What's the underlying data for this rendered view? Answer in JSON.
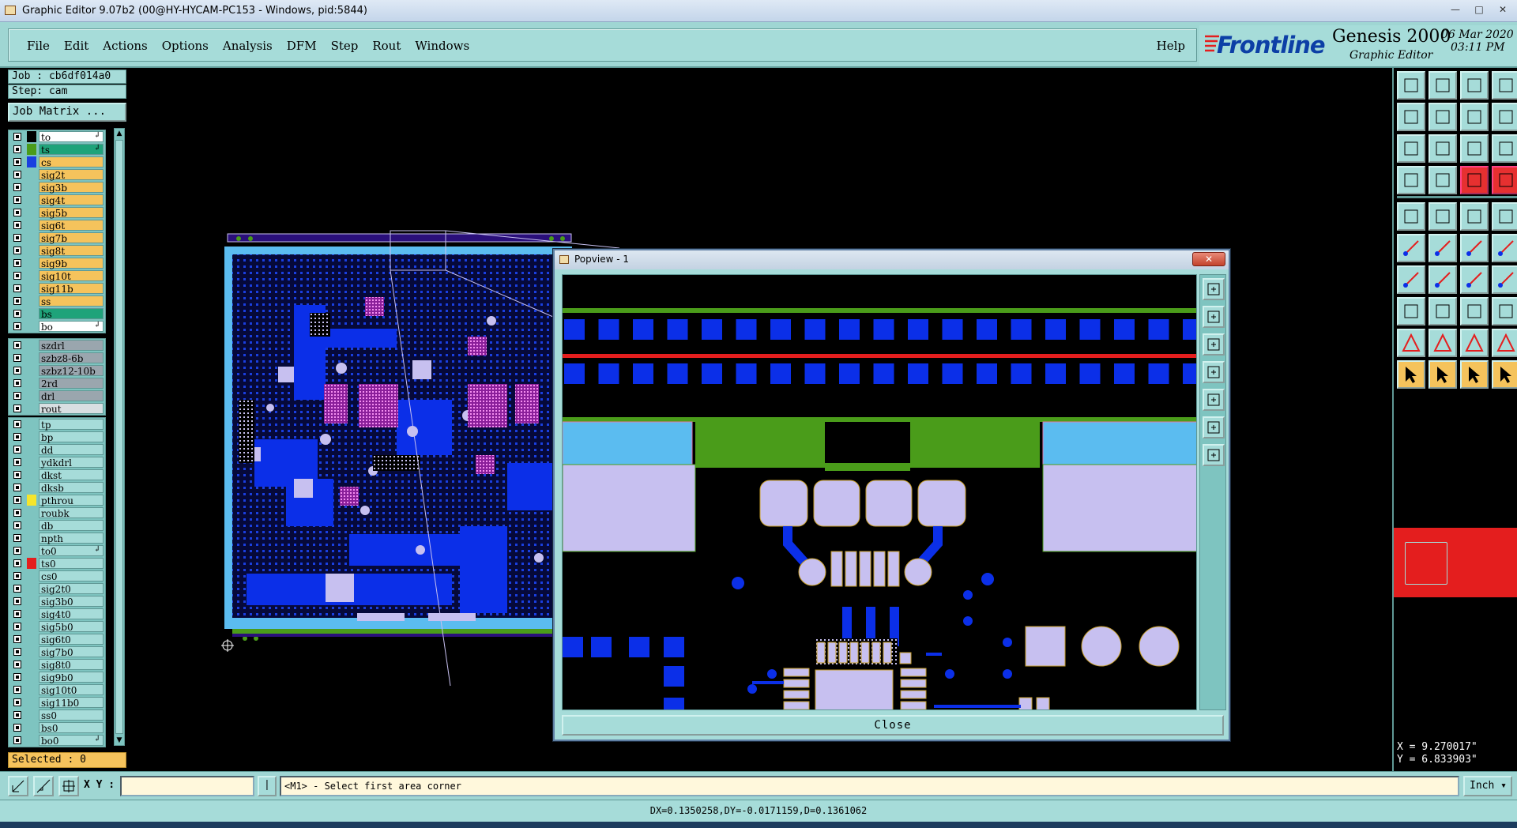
{
  "window": {
    "title": "Graphic Editor 9.07b2 (00@HY-HYCAM-PC153 - Windows, pid:5844)",
    "controls": [
      "—",
      "□",
      "✕"
    ]
  },
  "menu": {
    "items": [
      "File",
      "Edit",
      "Actions",
      "Options",
      "Analysis",
      "DFM",
      "Step",
      "Rout",
      "Windows"
    ],
    "help": "Help"
  },
  "brand": {
    "logo": "Frontline",
    "product": "Genesis 2000",
    "subtitle": "Graphic Editor",
    "date": "06 Mar 2020",
    "time": "03:11 PM"
  },
  "job": {
    "job_label": "Job : cb6df014a0",
    "step_label": "Step: cam",
    "matrix_button": "Job Matrix ..."
  },
  "layers_group1": [
    {
      "name": "to",
      "color": "#ffffff",
      "swatch": "#000000",
      "arrow": true
    },
    {
      "name": "ts",
      "color": "#1fa37a",
      "swatch": "#4a9c1a",
      "arrow": true
    },
    {
      "name": "cs",
      "color": "#f5c35c",
      "swatch": "#1a3fe0"
    },
    {
      "name": "sig2t",
      "color": "#f5c35c"
    },
    {
      "name": "sig3b",
      "color": "#f5c35c"
    },
    {
      "name": "sig4t",
      "color": "#f5c35c"
    },
    {
      "name": "sig5b",
      "color": "#f5c35c"
    },
    {
      "name": "sig6t",
      "color": "#f5c35c"
    },
    {
      "name": "sig7b",
      "color": "#f5c35c"
    },
    {
      "name": "sig8t",
      "color": "#f5c35c"
    },
    {
      "name": "sig9b",
      "color": "#f5c35c"
    },
    {
      "name": "sig10t",
      "color": "#f5c35c"
    },
    {
      "name": "sig11b",
      "color": "#f5c35c"
    },
    {
      "name": "ss",
      "color": "#f5c35c"
    },
    {
      "name": "bs",
      "color": "#1fa37a"
    },
    {
      "name": "bo",
      "color": "#ffffff",
      "arrow": true
    }
  ],
  "layers_group2": [
    {
      "name": "szdrl",
      "color": "#9aa6ae"
    },
    {
      "name": "szbz8-6b",
      "color": "#9aa6ae"
    },
    {
      "name": "szbz12-10b",
      "color": "#9aa6ae"
    },
    {
      "name": "2rd",
      "color": "#9aa6ae"
    },
    {
      "name": "drl",
      "color": "#9aa6ae"
    },
    {
      "name": "rout",
      "color": "#d8dfe2"
    }
  ],
  "layers_group3": [
    {
      "name": "tp",
      "color": "#a6dcd9"
    },
    {
      "name": "bp",
      "color": "#a6dcd9"
    },
    {
      "name": "dd",
      "color": "#a6dcd9"
    },
    {
      "name": "ydkdrl",
      "color": "#a6dcd9"
    },
    {
      "name": "dkst",
      "color": "#a6dcd9"
    },
    {
      "name": "dksb",
      "color": "#a6dcd9"
    },
    {
      "name": "pthrou",
      "color": "#a6dcd9",
      "swatch": "#f5e52c"
    },
    {
      "name": "roubk",
      "color": "#a6dcd9"
    },
    {
      "name": "db",
      "color": "#a6dcd9"
    },
    {
      "name": "npth",
      "color": "#a6dcd9"
    },
    {
      "name": "to0",
      "color": "#a6dcd9",
      "arrow": true
    },
    {
      "name": "ts0",
      "color": "#a6dcd9",
      "swatch": "#e41e1e"
    },
    {
      "name": "cs0",
      "color": "#a6dcd9"
    },
    {
      "name": "sig2t0",
      "color": "#a6dcd9"
    },
    {
      "name": "sig3b0",
      "color": "#a6dcd9"
    },
    {
      "name": "sig4t0",
      "color": "#a6dcd9"
    },
    {
      "name": "sig5b0",
      "color": "#a6dcd9"
    },
    {
      "name": "sig6t0",
      "color": "#a6dcd9"
    },
    {
      "name": "sig7b0",
      "color": "#a6dcd9"
    },
    {
      "name": "sig8t0",
      "color": "#a6dcd9"
    },
    {
      "name": "sig9b0",
      "color": "#a6dcd9"
    },
    {
      "name": "sig10t0",
      "color": "#a6dcd9"
    },
    {
      "name": "sig11b0",
      "color": "#a6dcd9"
    },
    {
      "name": "ss0",
      "color": "#a6dcd9"
    },
    {
      "name": "bs0",
      "color": "#a6dcd9"
    },
    {
      "name": "bo0",
      "color": "#a6dcd9",
      "arrow": true
    }
  ],
  "selected_label": "Selected : 0",
  "popview": {
    "title": "Popview - 1",
    "close_x": "✕",
    "close_button": "Close"
  },
  "coords": {
    "x": "X = 9.270017\"",
    "y": "Y = 6.833903\""
  },
  "command": {
    "xy_label": "X Y :",
    "xy_value": "",
    "prompt": "<M1> - Select first area corner",
    "units": "Inch"
  },
  "measure": "DX=0.1350258,DY=-0.0171159,D=0.1361062",
  "colors": {
    "panel": "#a6dcd9",
    "panel_dark": "#7ec4c0",
    "pad_blue": "#0b2fe8",
    "pad_lavender": "#c7c0f0",
    "green": "#4a9c1a",
    "light_blue": "#5bbcf0",
    "red": "#e41e1e"
  }
}
